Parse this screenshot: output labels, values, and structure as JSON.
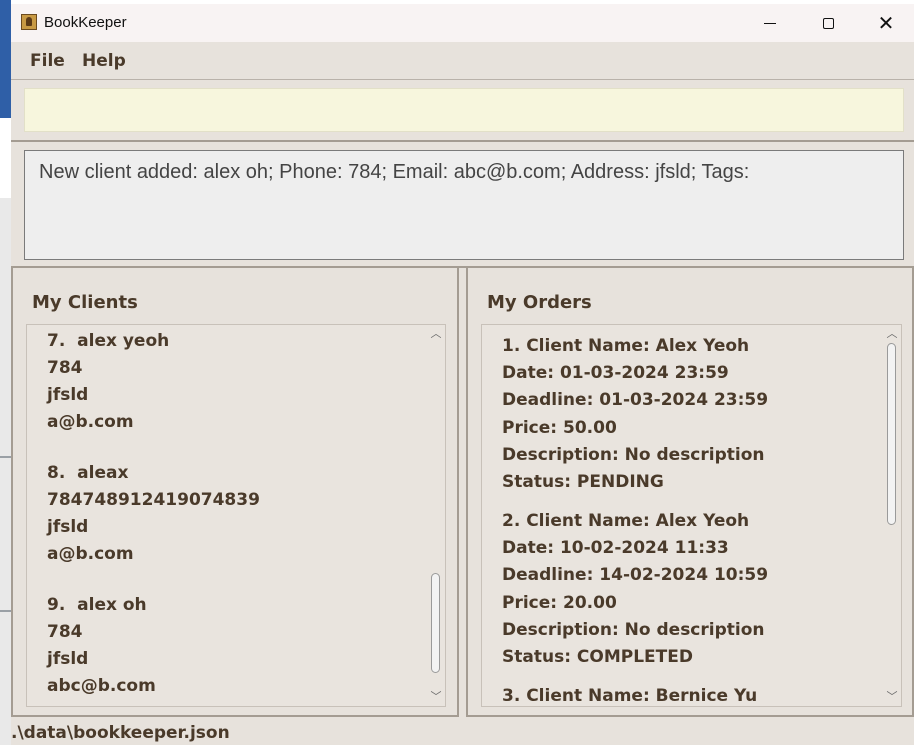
{
  "window": {
    "title": "BookKeeper"
  },
  "menu": {
    "file": "File",
    "help": "Help"
  },
  "command": {
    "value": "",
    "placeholder": ""
  },
  "result": {
    "text": "New client added: alex oh; Phone: 784; Email: abc@b.com; Address: jfsld; Tags:"
  },
  "clients": {
    "title": "My Clients",
    "items": [
      {
        "index": "7.",
        "name": "alex yeoh",
        "phone": "784",
        "address": "jfsld",
        "email": "a@b.com"
      },
      {
        "index": "8.",
        "name": "aleax",
        "phone": "784748912419074839",
        "address": "jfsld",
        "email": "a@b.com"
      },
      {
        "index": "9.",
        "name": "alex oh",
        "phone": "784",
        "address": "jfsld",
        "email": "abc@b.com"
      }
    ],
    "scroll_fraction": 0.94
  },
  "orders": {
    "title": "My Orders",
    "items": [
      {
        "header": "1.  Client Name: Alex Yeoh",
        "date": "Date: 01-03-2024 23:59",
        "deadline": "Deadline: 01-03-2024 23:59",
        "price": "Price: 50.00",
        "description": "Description: No description",
        "status": "Status: PENDING"
      },
      {
        "header": "2.  Client Name: Alex Yeoh",
        "date": "Date: 10-02-2024 11:33",
        "deadline": "Deadline: 14-02-2024 10:59",
        "price": "Price: 20.00",
        "description": "Description: No description",
        "status": "Status: COMPLETED"
      },
      {
        "header": "3.  Client Name: Bernice Yu"
      }
    ],
    "scroll_fraction": 0.0
  },
  "status": {
    "path": ".\\data\\bookkeeper.json"
  }
}
